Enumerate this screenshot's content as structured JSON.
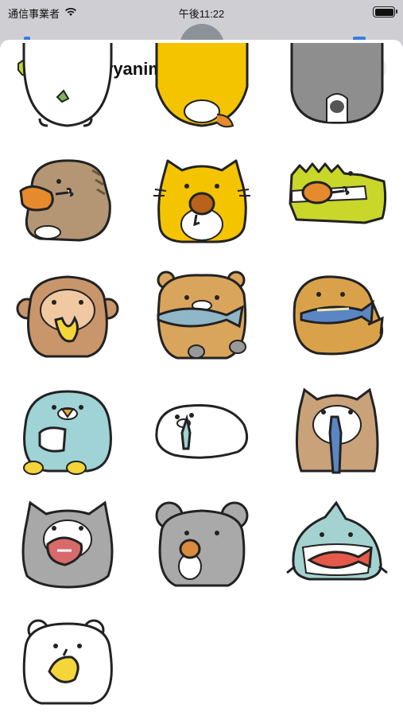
{
  "status_bar": {
    "carrier": "通信事業者",
    "time": "午後11:22",
    "wifi_icon": "wifi-icon",
    "battery_icon": "battery-icon"
  },
  "header": {
    "title": "hungryanimal",
    "app_icon": "crocodile-icon",
    "close_icon": "close-icon"
  },
  "stickers": [
    {
      "name": "penguin-partial",
      "color": "#ffffff"
    },
    {
      "name": "yellow-cat-partial",
      "color": "#f4c400"
    },
    {
      "name": "gray-animal-partial",
      "color": "#8e8e8e"
    },
    {
      "name": "dinosaur-chicken",
      "color": "#b49675"
    },
    {
      "name": "yellow-cat-chicken",
      "color": "#f4c400"
    },
    {
      "name": "crocodile-chicken",
      "color": "#c9d62a"
    },
    {
      "name": "monkey-banana",
      "color": "#c9956b"
    },
    {
      "name": "bear-fish",
      "color": "#d9a45b"
    },
    {
      "name": "walrus-fish",
      "color": "#d9a24a"
    },
    {
      "name": "penguin-rice",
      "color": "#9fd3d5"
    },
    {
      "name": "seal-fish",
      "color": "#ffffff"
    },
    {
      "name": "shiba-fish",
      "color": "#c9a27a"
    },
    {
      "name": "cat-meat",
      "color": "#a8a8a8"
    },
    {
      "name": "chinchilla-nut",
      "color": "#a9a9a9"
    },
    {
      "name": "shark-fish",
      "color": "#a3d2d0"
    },
    {
      "name": "white-bear-lemon",
      "color": "#ffffff"
    }
  ]
}
